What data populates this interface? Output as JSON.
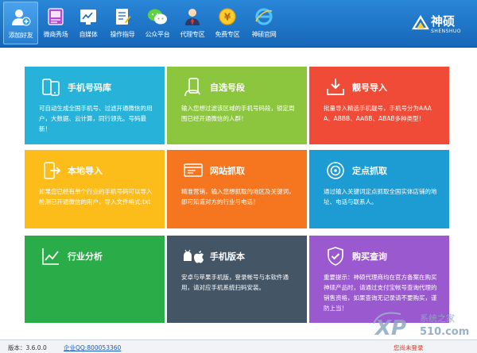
{
  "toolbar": {
    "items": [
      {
        "label": "添加好友",
        "icon": "add-friend-icon"
      },
      {
        "label": "微商秀场",
        "icon": "showroom-icon"
      },
      {
        "label": "自媒体",
        "icon": "media-chart-icon"
      },
      {
        "label": "操作指导",
        "icon": "guide-icon"
      },
      {
        "label": "公众平台",
        "icon": "wechat-icon"
      },
      {
        "label": "代理专区",
        "icon": "agent-icon"
      },
      {
        "label": "免费专区",
        "icon": "free-coin-icon"
      },
      {
        "label": "神硕官网",
        "icon": "ie-browser-icon"
      }
    ],
    "active_index": 0
  },
  "logo": {
    "cn": "神硕",
    "en": "SHENSHUO"
  },
  "tiles": [
    {
      "title": "手机号码库",
      "desc": "可自动生成全国手机号、过滤开通微信的用户，大数据、云计算，同行领先。号码最新！",
      "color": "#27b3d9",
      "icon": "phones-icon"
    },
    {
      "title": "自选号段",
      "desc": "输入您想过滤该区域的手机号码段，锁定周围已经开通微信的人群！",
      "color": "#8cc63f",
      "icon": "phone-hand-icon"
    },
    {
      "title": "靓号导入",
      "desc": "批量导入精选手机靓号，手机号分为AAAA、ABBB、AABB、ABAB多种类型！",
      "color": "#ef4b36",
      "icon": "import-tray-icon"
    },
    {
      "title": "本地导入",
      "desc": "如果您已经有单个行业的手机号码可以导入检测已开通微信的用户，导入文件格式:txt",
      "color": "#fcbd1a",
      "icon": "local-import-icon"
    },
    {
      "title": "网站抓取",
      "desc": "精准营销，输入您想抓取的地区及关键词，即可知道对方的行业与电话！",
      "color": "#f5761f",
      "icon": "web-grab-icon"
    },
    {
      "title": "定点抓取",
      "desc": "通过输入关键词定点抓取全国实体店铺的地址、电话与联系人。",
      "color": "#1d9bd3",
      "icon": "target-icon"
    },
    {
      "title": "行业分析",
      "desc": "",
      "color": "#2aac48",
      "icon": "trend-chart-icon"
    },
    {
      "title": "手机版本",
      "desc": "安卓与苹果手机版，登录帐号与本软件通用，请对应手机系统扫码安装。",
      "color": "#445666",
      "icon": "android-apple-icon"
    },
    {
      "title": "购买查询",
      "desc": "重要提示：神硕代理商均在官方备案在购买神硕产品时，请通过支付宝帐号查询代理的销售资格，如果查询无记录请不要购买，谨防上当！",
      "color": "#9b59d0",
      "icon": "shield-check-icon"
    }
  ],
  "status": {
    "version": "版本：3.6.0.0",
    "qq": "企业QQ:800053360",
    "login": "您尚未登录"
  },
  "watermark": {
    "brand": "XP",
    "site": "系统之家",
    "domain": "510.com"
  }
}
